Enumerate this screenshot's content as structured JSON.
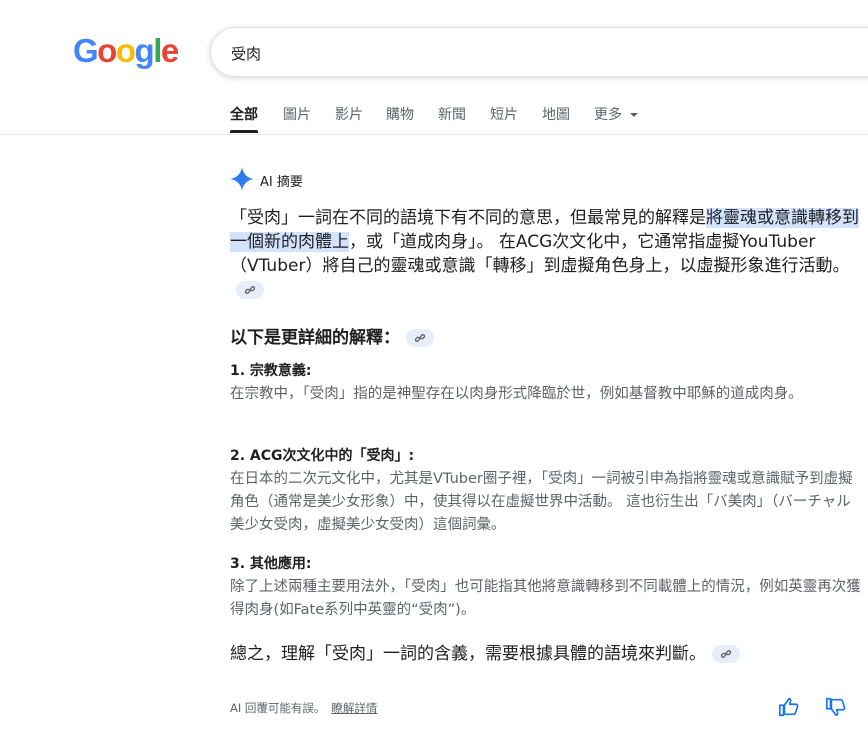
{
  "header": {
    "logo_text": "Google",
    "logo_colors": [
      "#4285F4",
      "#EA4335",
      "#FBBC05",
      "#4285F4",
      "#34A853",
      "#EA4335"
    ],
    "search_query": "受肉"
  },
  "tabs": [
    {
      "label": "全部",
      "active": true
    },
    {
      "label": "圖片"
    },
    {
      "label": "影片"
    },
    {
      "label": "購物"
    },
    {
      "label": "新聞"
    },
    {
      "label": "短片"
    },
    {
      "label": "地圖"
    },
    {
      "label": "更多"
    }
  ],
  "ai_overview": {
    "title": "AI 摘要",
    "intro_part1": "「受肉」一詞在不同的語境下有不同的意思，但最常見的解釋是",
    "intro_highlight": "將靈魂或意識轉移到一個新的肉體上",
    "intro_part2": "，或「道成肉身」。 在ACG次文化中，它通常指虛擬YouTuber（VTuber）將自己的靈魂或意識「轉移」到虛擬角色身上，以虛擬形象進行活動。",
    "details_heading": "以下是更詳細的解釋：",
    "items": [
      {
        "title": "1. 宗教意義:",
        "body": "在宗教中，「受肉」指的是神聖存在以肉身形式降臨於世，例如基督教中耶穌的道成肉身。"
      },
      {
        "title": "2. ACG次文化中的「受肉」:",
        "body": "在日本的二次元文化中，尤其是VTuber圈子裡，「受肉」一詞被引申為指將靈魂或意識賦予到虛擬角色（通常是美少女形象）中，使其得以在虛擬世界中活動。 這也衍生出「バ美肉」（バーチャル美少女受肉，虛擬美少女受肉）這個詞彙。"
      },
      {
        "title": "3. 其他應用:",
        "body": "除了上述兩種主要用法外，「受肉」也可能指其他將意識轉移到不同載體上的情況，例如英靈再次獲得肉身(如Fate系列中英靈的“受肉”)。"
      }
    ],
    "conclusion": "總之，理解「受肉」一詞的含義，需要根據具體的語境來判斷。",
    "footer_note": "AI 回覆可能有誤。",
    "learn_more": "瞭解詳情"
  },
  "colors": {
    "accent_blue": "#1a73e8",
    "highlight": "#d3e3fd",
    "secondary_text": "#5f6368"
  }
}
